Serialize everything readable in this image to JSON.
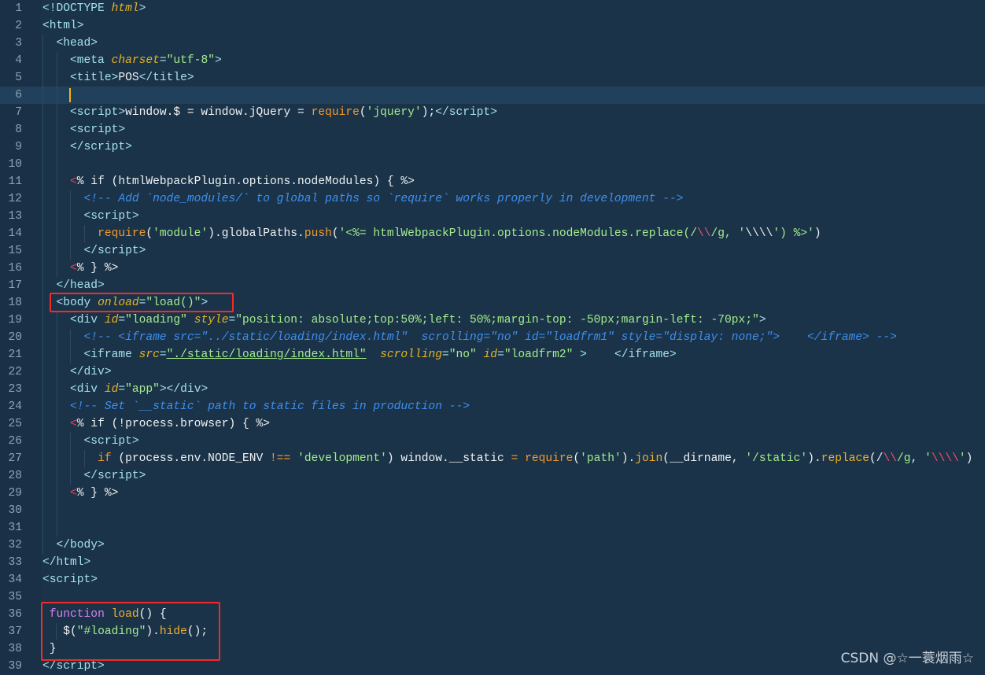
{
  "editor": {
    "current_line": 6,
    "lines": [
      [
        [
          "t",
          "<!DOCTYPE "
        ],
        [
          "a",
          "html"
        ],
        [
          "t",
          ">"
        ]
      ],
      [
        [
          "t",
          "<html>"
        ]
      ],
      [
        [
          "t",
          "  <head>"
        ]
      ],
      [
        [
          "t",
          "    <meta "
        ],
        [
          "a",
          "charset"
        ],
        [
          "t",
          "="
        ],
        [
          "s",
          "\"utf-8\""
        ],
        [
          "t",
          ">"
        ]
      ],
      [
        [
          "t",
          "    <title>"
        ],
        [
          "p",
          "POS"
        ],
        [
          "t",
          "</title>"
        ]
      ],
      [],
      [
        [
          "t",
          "    <script>"
        ],
        [
          "p",
          "window.$ = window.jQuery = "
        ],
        [
          "k",
          "require"
        ],
        [
          "p",
          "("
        ],
        [
          "s",
          "'jquery'"
        ],
        [
          "p",
          ");"
        ],
        [
          "t",
          "</script>"
        ]
      ],
      [
        [
          "t",
          "    <script>"
        ]
      ],
      [
        [
          "t",
          "    </script>"
        ]
      ],
      [],
      [
        [
          "p",
          "    "
        ],
        [
          "r",
          "<"
        ],
        [
          "p",
          "% if (htmlWebpackPlugin.options.nodeModules) { %>"
        ]
      ],
      [
        [
          "p",
          "      "
        ],
        [
          "c",
          "<!-- Add `node_modules/` to global paths so `require` works properly in development -->"
        ]
      ],
      [
        [
          "t",
          "      <script>"
        ]
      ],
      [
        [
          "p",
          "        "
        ],
        [
          "k",
          "require"
        ],
        [
          "p",
          "("
        ],
        [
          "s",
          "'module'"
        ],
        [
          "p",
          ").globalPaths."
        ],
        [
          "k",
          "push"
        ],
        [
          "p",
          "("
        ],
        [
          "s",
          "'<%= htmlWebpackPlugin.options.nodeModules.replace(/"
        ],
        [
          "rx",
          "\\\\"
        ],
        [
          "s",
          "/g, '"
        ],
        [
          "p",
          "\\\\\\\\"
        ],
        [
          "s",
          "') %>'"
        ],
        [
          "p",
          ")"
        ]
      ],
      [
        [
          "t",
          "      </script>"
        ]
      ],
      [
        [
          "p",
          "    "
        ],
        [
          "r",
          "<"
        ],
        [
          "p",
          "% } %>"
        ]
      ],
      [
        [
          "t",
          "  </head>"
        ]
      ],
      [
        [
          "t",
          "  <body "
        ],
        [
          "a",
          "onload"
        ],
        [
          "t",
          "="
        ],
        [
          "s",
          "\"load()\""
        ],
        [
          "t",
          ">"
        ]
      ],
      [
        [
          "t",
          "    <div "
        ],
        [
          "a",
          "id"
        ],
        [
          "t",
          "="
        ],
        [
          "s",
          "\"loading\" "
        ],
        [
          "a",
          "style"
        ],
        [
          "t",
          "="
        ],
        [
          "s",
          "\"position: absolute;top:50%;left: 50%;margin-top: -50px;margin-left: -70px;\""
        ],
        [
          "t",
          ">"
        ]
      ],
      [
        [
          "p",
          "      "
        ],
        [
          "c",
          "<!-- <iframe src=\"../static/loading/index.html\"  scrolling=\"no\" id=\"loadfrm1\" style=\"display: none;\">    </iframe> -->"
        ]
      ],
      [
        [
          "t",
          "      <iframe "
        ],
        [
          "a",
          "src"
        ],
        [
          "t",
          "="
        ],
        [
          "s",
          "\"./static/loading/index.html\""
        ],
        [
          "p",
          "  "
        ],
        [
          "a",
          "scrolling"
        ],
        [
          "t",
          "="
        ],
        [
          "s",
          "\"no\" "
        ],
        [
          "a",
          "id"
        ],
        [
          "t",
          "="
        ],
        [
          "s",
          "\"loadfrm2\""
        ],
        [
          "t",
          " >    </iframe>"
        ]
      ],
      [
        [
          "t",
          "    </div>"
        ]
      ],
      [
        [
          "t",
          "    <div "
        ],
        [
          "a",
          "id"
        ],
        [
          "t",
          "="
        ],
        [
          "s",
          "\"app\""
        ],
        [
          "t",
          "></div>"
        ]
      ],
      [
        [
          "p",
          "    "
        ],
        [
          "c",
          "<!-- Set `__static` path to static files in production -->"
        ]
      ],
      [
        [
          "p",
          "    "
        ],
        [
          "r",
          "<"
        ],
        [
          "p",
          "% if (!process.browser) { %>"
        ]
      ],
      [
        [
          "t",
          "      <script>"
        ]
      ],
      [
        [
          "p",
          "        "
        ],
        [
          "k",
          "if"
        ],
        [
          "p",
          " (process.env.NODE_ENV "
        ],
        [
          "k",
          "!=="
        ],
        [
          "p",
          " "
        ],
        [
          "s",
          "'development'"
        ],
        [
          "p",
          ") window.__static "
        ],
        [
          "k",
          "="
        ],
        [
          "p",
          " "
        ],
        [
          "k",
          "require"
        ],
        [
          "p",
          "("
        ],
        [
          "s",
          "'path'"
        ],
        [
          "p",
          ")."
        ],
        [
          "m",
          "join"
        ],
        [
          "p",
          "(__dirname, "
        ],
        [
          "s",
          "'/static'"
        ],
        [
          "p",
          ")."
        ],
        [
          "m",
          "replace"
        ],
        [
          "p",
          "(/"
        ],
        [
          "rx",
          "\\\\"
        ],
        [
          "s",
          "/g"
        ],
        [
          "p",
          ", "
        ],
        [
          "s",
          "'"
        ],
        [
          "rx",
          "\\\\\\\\"
        ],
        [
          "s",
          "'"
        ],
        [
          "p",
          ")"
        ]
      ],
      [
        [
          "t",
          "      </script>"
        ]
      ],
      [
        [
          "p",
          "    "
        ],
        [
          "r",
          "<"
        ],
        [
          "p",
          "% } %>"
        ]
      ],
      [],
      [],
      [
        [
          "t",
          "  </body>"
        ]
      ],
      [
        [
          "t",
          "</html>"
        ]
      ],
      [
        [
          "t",
          "<script>"
        ]
      ],
      [],
      [
        [
          "p",
          " "
        ],
        [
          "f",
          "function "
        ],
        [
          "m",
          "load"
        ],
        [
          "p",
          "() {"
        ]
      ],
      [
        [
          "p",
          "   $("
        ],
        [
          "s",
          "\"#loading\""
        ],
        [
          "p",
          ")."
        ],
        [
          "m",
          "hide"
        ],
        [
          "p",
          "();"
        ]
      ],
      [
        [
          "p",
          " }"
        ]
      ],
      [
        [
          "t",
          "</script>"
        ]
      ]
    ]
  },
  "watermark": "CSDN @☆一蓑烟雨☆",
  "colors": {
    "background": "#1b3349",
    "highlight_box": "#f22a2a",
    "cursor": "#f2b705"
  }
}
